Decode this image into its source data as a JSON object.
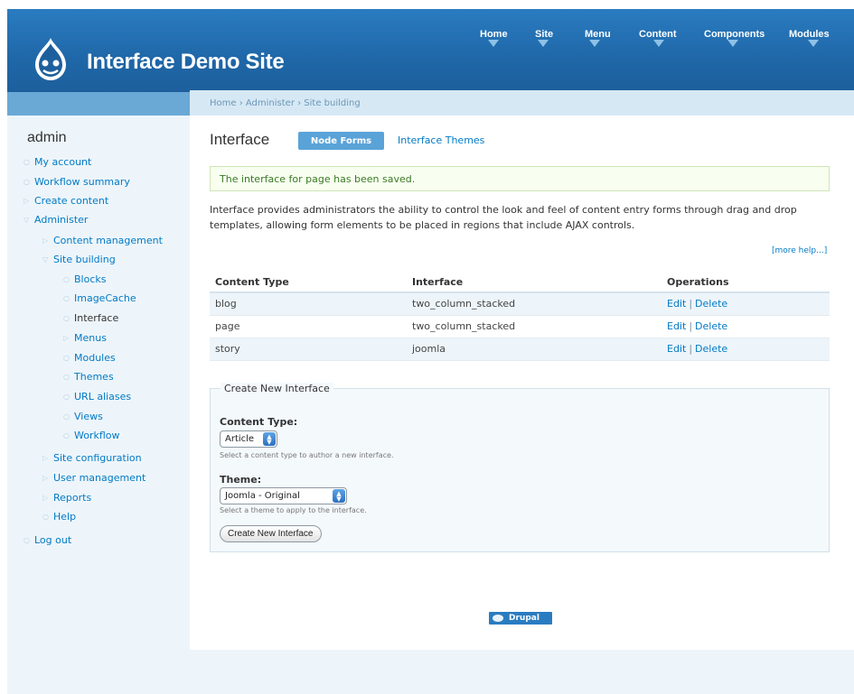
{
  "site": {
    "name": "Interface Demo Site"
  },
  "top_nav": [
    {
      "label": "Home"
    },
    {
      "label": "Site"
    },
    {
      "label": "Menu"
    },
    {
      "label": "Content"
    },
    {
      "label": "Components"
    },
    {
      "label": "Modules"
    }
  ],
  "sidebar": {
    "username": "admin",
    "items": [
      {
        "label": "My account"
      },
      {
        "label": "Workflow summary"
      },
      {
        "label": "Create content"
      },
      {
        "label": "Administer"
      },
      {
        "label": "Content management"
      },
      {
        "label": "Site building"
      },
      {
        "label": "Blocks"
      },
      {
        "label": "ImageCache"
      },
      {
        "label": "Interface"
      },
      {
        "label": "Menus"
      },
      {
        "label": "Modules"
      },
      {
        "label": "Themes"
      },
      {
        "label": "URL aliases"
      },
      {
        "label": "Views"
      },
      {
        "label": "Workflow"
      },
      {
        "label": "Site configuration"
      },
      {
        "label": "User management"
      },
      {
        "label": "Reports"
      },
      {
        "label": "Help"
      },
      {
        "label": "Log out"
      }
    ]
  },
  "breadcrumb": "Home › Administer › Site building",
  "page": {
    "title": "Interface",
    "tabs": [
      {
        "label": "Node Forms",
        "active": true
      },
      {
        "label": "Interface Themes",
        "active": false
      }
    ],
    "status_message": "The interface for page has been saved.",
    "intro": "Interface provides administrators the ability to control the look and feel of content entry forms through drag and drop templates, allowing form elements to be placed in regions that include AJAX controls.",
    "more_help": "[more help...]"
  },
  "table": {
    "headers": [
      "Content Type",
      "Interface",
      "Operations"
    ],
    "rows": [
      {
        "type": "blog",
        "interface": "two_column_stacked",
        "edit": "Edit",
        "delete": "Delete"
      },
      {
        "type": "page",
        "interface": "two_column_stacked",
        "edit": "Edit",
        "delete": "Delete"
      },
      {
        "type": "story",
        "interface": "joomla",
        "edit": "Edit",
        "delete": "Delete"
      }
    ],
    "separator": "|"
  },
  "form": {
    "legend": "Create New Interface",
    "content_type": {
      "label": "Content Type:",
      "value": "Article",
      "description": "Select a content type to author a new interface."
    },
    "theme": {
      "label": "Theme:",
      "value": "Joomla - Original",
      "description": "Select a theme to apply to the interface."
    },
    "submit_label": "Create New Interface"
  },
  "footer": {
    "badge": "Drupal"
  },
  "colors": {
    "header": "#1f67a8",
    "link": "#027ac6",
    "active_tab": "#5aa3d8"
  }
}
